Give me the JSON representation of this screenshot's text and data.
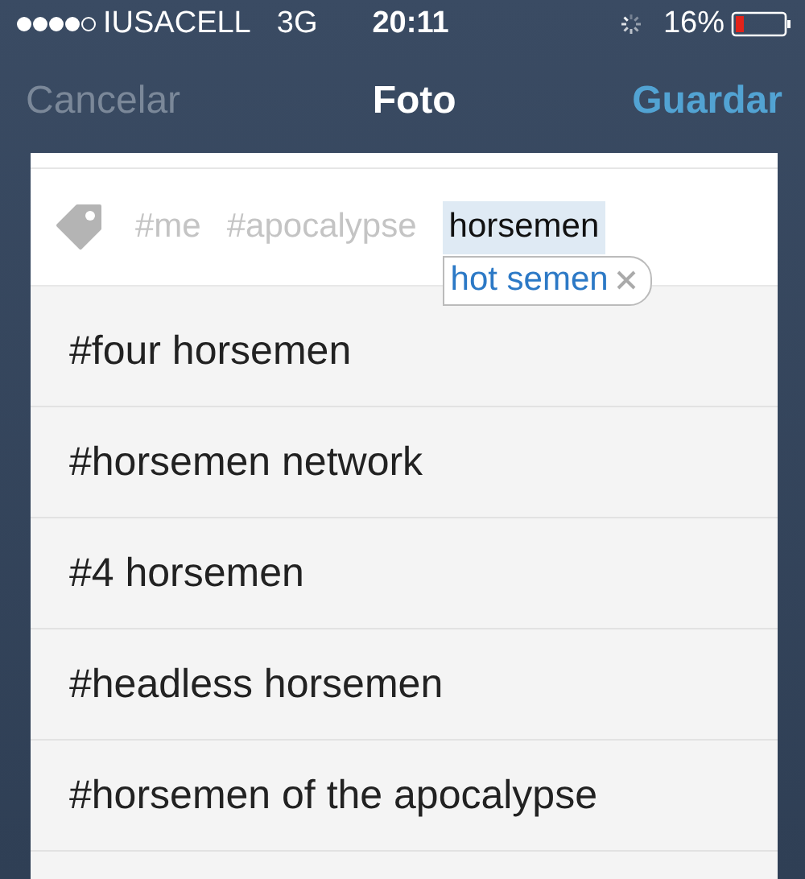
{
  "status_bar": {
    "carrier": "IUSACELL",
    "network": "3G",
    "time": "20:11",
    "battery": "16%"
  },
  "nav_bar": {
    "cancel": "Cancelar",
    "title": "Foto",
    "save": "Guardar"
  },
  "tag_field": {
    "tags": [
      "#me",
      "#apocalypse"
    ],
    "value": "horsemen",
    "autocorrect": "hot semen"
  },
  "suggestions": [
    "#four horsemen",
    "#horsemen network",
    "#4 horsemen",
    "#headless horsemen",
    "#horsemen of the apocalypse"
  ]
}
